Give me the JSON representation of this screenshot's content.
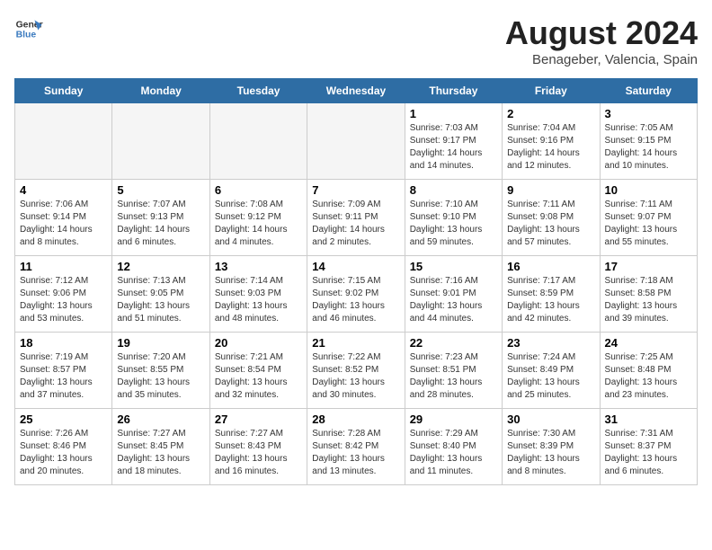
{
  "header": {
    "logo_line1": "General",
    "logo_line2": "Blue",
    "main_title": "August 2024",
    "subtitle": "Benageber, Valencia, Spain"
  },
  "weekdays": [
    "Sunday",
    "Monday",
    "Tuesday",
    "Wednesday",
    "Thursday",
    "Friday",
    "Saturday"
  ],
  "weeks": [
    [
      {
        "day": "",
        "info": "",
        "empty": true
      },
      {
        "day": "",
        "info": "",
        "empty": true
      },
      {
        "day": "",
        "info": "",
        "empty": true
      },
      {
        "day": "",
        "info": "",
        "empty": true
      },
      {
        "day": "1",
        "info": "Sunrise: 7:03 AM\nSunset: 9:17 PM\nDaylight: 14 hours\nand 14 minutes.",
        "empty": false
      },
      {
        "day": "2",
        "info": "Sunrise: 7:04 AM\nSunset: 9:16 PM\nDaylight: 14 hours\nand 12 minutes.",
        "empty": false
      },
      {
        "day": "3",
        "info": "Sunrise: 7:05 AM\nSunset: 9:15 PM\nDaylight: 14 hours\nand 10 minutes.",
        "empty": false
      }
    ],
    [
      {
        "day": "4",
        "info": "Sunrise: 7:06 AM\nSunset: 9:14 PM\nDaylight: 14 hours\nand 8 minutes.",
        "empty": false
      },
      {
        "day": "5",
        "info": "Sunrise: 7:07 AM\nSunset: 9:13 PM\nDaylight: 14 hours\nand 6 minutes.",
        "empty": false
      },
      {
        "day": "6",
        "info": "Sunrise: 7:08 AM\nSunset: 9:12 PM\nDaylight: 14 hours\nand 4 minutes.",
        "empty": false
      },
      {
        "day": "7",
        "info": "Sunrise: 7:09 AM\nSunset: 9:11 PM\nDaylight: 14 hours\nand 2 minutes.",
        "empty": false
      },
      {
        "day": "8",
        "info": "Sunrise: 7:10 AM\nSunset: 9:10 PM\nDaylight: 13 hours\nand 59 minutes.",
        "empty": false
      },
      {
        "day": "9",
        "info": "Sunrise: 7:11 AM\nSunset: 9:08 PM\nDaylight: 13 hours\nand 57 minutes.",
        "empty": false
      },
      {
        "day": "10",
        "info": "Sunrise: 7:11 AM\nSunset: 9:07 PM\nDaylight: 13 hours\nand 55 minutes.",
        "empty": false
      }
    ],
    [
      {
        "day": "11",
        "info": "Sunrise: 7:12 AM\nSunset: 9:06 PM\nDaylight: 13 hours\nand 53 minutes.",
        "empty": false
      },
      {
        "day": "12",
        "info": "Sunrise: 7:13 AM\nSunset: 9:05 PM\nDaylight: 13 hours\nand 51 minutes.",
        "empty": false
      },
      {
        "day": "13",
        "info": "Sunrise: 7:14 AM\nSunset: 9:03 PM\nDaylight: 13 hours\nand 48 minutes.",
        "empty": false
      },
      {
        "day": "14",
        "info": "Sunrise: 7:15 AM\nSunset: 9:02 PM\nDaylight: 13 hours\nand 46 minutes.",
        "empty": false
      },
      {
        "day": "15",
        "info": "Sunrise: 7:16 AM\nSunset: 9:01 PM\nDaylight: 13 hours\nand 44 minutes.",
        "empty": false
      },
      {
        "day": "16",
        "info": "Sunrise: 7:17 AM\nSunset: 8:59 PM\nDaylight: 13 hours\nand 42 minutes.",
        "empty": false
      },
      {
        "day": "17",
        "info": "Sunrise: 7:18 AM\nSunset: 8:58 PM\nDaylight: 13 hours\nand 39 minutes.",
        "empty": false
      }
    ],
    [
      {
        "day": "18",
        "info": "Sunrise: 7:19 AM\nSunset: 8:57 PM\nDaylight: 13 hours\nand 37 minutes.",
        "empty": false
      },
      {
        "day": "19",
        "info": "Sunrise: 7:20 AM\nSunset: 8:55 PM\nDaylight: 13 hours\nand 35 minutes.",
        "empty": false
      },
      {
        "day": "20",
        "info": "Sunrise: 7:21 AM\nSunset: 8:54 PM\nDaylight: 13 hours\nand 32 minutes.",
        "empty": false
      },
      {
        "day": "21",
        "info": "Sunrise: 7:22 AM\nSunset: 8:52 PM\nDaylight: 13 hours\nand 30 minutes.",
        "empty": false
      },
      {
        "day": "22",
        "info": "Sunrise: 7:23 AM\nSunset: 8:51 PM\nDaylight: 13 hours\nand 28 minutes.",
        "empty": false
      },
      {
        "day": "23",
        "info": "Sunrise: 7:24 AM\nSunset: 8:49 PM\nDaylight: 13 hours\nand 25 minutes.",
        "empty": false
      },
      {
        "day": "24",
        "info": "Sunrise: 7:25 AM\nSunset: 8:48 PM\nDaylight: 13 hours\nand 23 minutes.",
        "empty": false
      }
    ],
    [
      {
        "day": "25",
        "info": "Sunrise: 7:26 AM\nSunset: 8:46 PM\nDaylight: 13 hours\nand 20 minutes.",
        "empty": false
      },
      {
        "day": "26",
        "info": "Sunrise: 7:27 AM\nSunset: 8:45 PM\nDaylight: 13 hours\nand 18 minutes.",
        "empty": false
      },
      {
        "day": "27",
        "info": "Sunrise: 7:27 AM\nSunset: 8:43 PM\nDaylight: 13 hours\nand 16 minutes.",
        "empty": false
      },
      {
        "day": "28",
        "info": "Sunrise: 7:28 AM\nSunset: 8:42 PM\nDaylight: 13 hours\nand 13 minutes.",
        "empty": false
      },
      {
        "day": "29",
        "info": "Sunrise: 7:29 AM\nSunset: 8:40 PM\nDaylight: 13 hours\nand 11 minutes.",
        "empty": false
      },
      {
        "day": "30",
        "info": "Sunrise: 7:30 AM\nSunset: 8:39 PM\nDaylight: 13 hours\nand 8 minutes.",
        "empty": false
      },
      {
        "day": "31",
        "info": "Sunrise: 7:31 AM\nSunset: 8:37 PM\nDaylight: 13 hours\nand 6 minutes.",
        "empty": false
      }
    ]
  ]
}
